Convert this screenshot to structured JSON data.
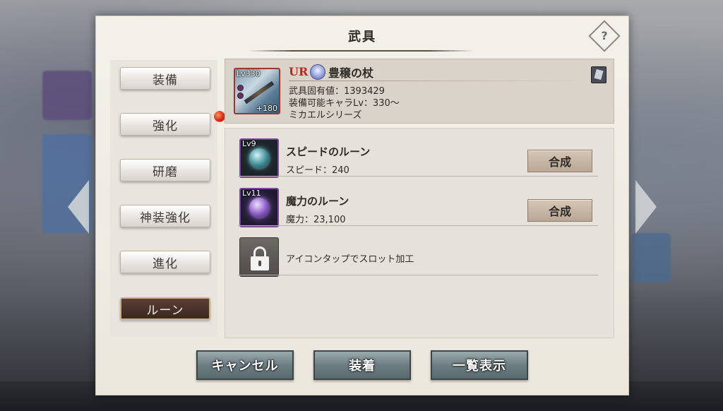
{
  "modal": {
    "title": "武具"
  },
  "tabs": [
    {
      "label": "装備",
      "active": false
    },
    {
      "label": "強化",
      "active": false,
      "has_notification": true
    },
    {
      "label": "研磨",
      "active": false
    },
    {
      "label": "神装強化",
      "active": false
    },
    {
      "label": "進化",
      "active": false
    },
    {
      "label": "ルーン",
      "active": true
    }
  ],
  "weapon": {
    "level": "Lv330",
    "plus": "+180",
    "rarity": "UR",
    "name": "豊穣の杖",
    "unique_value": "武具固有値：1393429",
    "equip_level": "装備可能キャラLv：330～",
    "series": "ミカエルシリーズ",
    "frame_color": "#a1352d"
  },
  "runes": [
    {
      "level": "Lv9",
      "name": "スピードのルーン",
      "stat": "スピード：240",
      "button": "合成",
      "icon": "speed-rune-icon"
    },
    {
      "level": "Lv11",
      "name": "魔力のルーン",
      "stat": "魔力：23,100",
      "button": "合成",
      "icon": "magic-rune-icon"
    }
  ],
  "locked_slot": {
    "text": "アイコンタップでスロット加工",
    "icon": "lock-icon"
  },
  "buttons": {
    "cancel": "キャンセル",
    "equip": "装着",
    "list_view": "一覧表示"
  },
  "colors": {
    "accent_red": "#c0261e",
    "notification": "#d52b12",
    "rune_frame": "#7a4a9a"
  }
}
